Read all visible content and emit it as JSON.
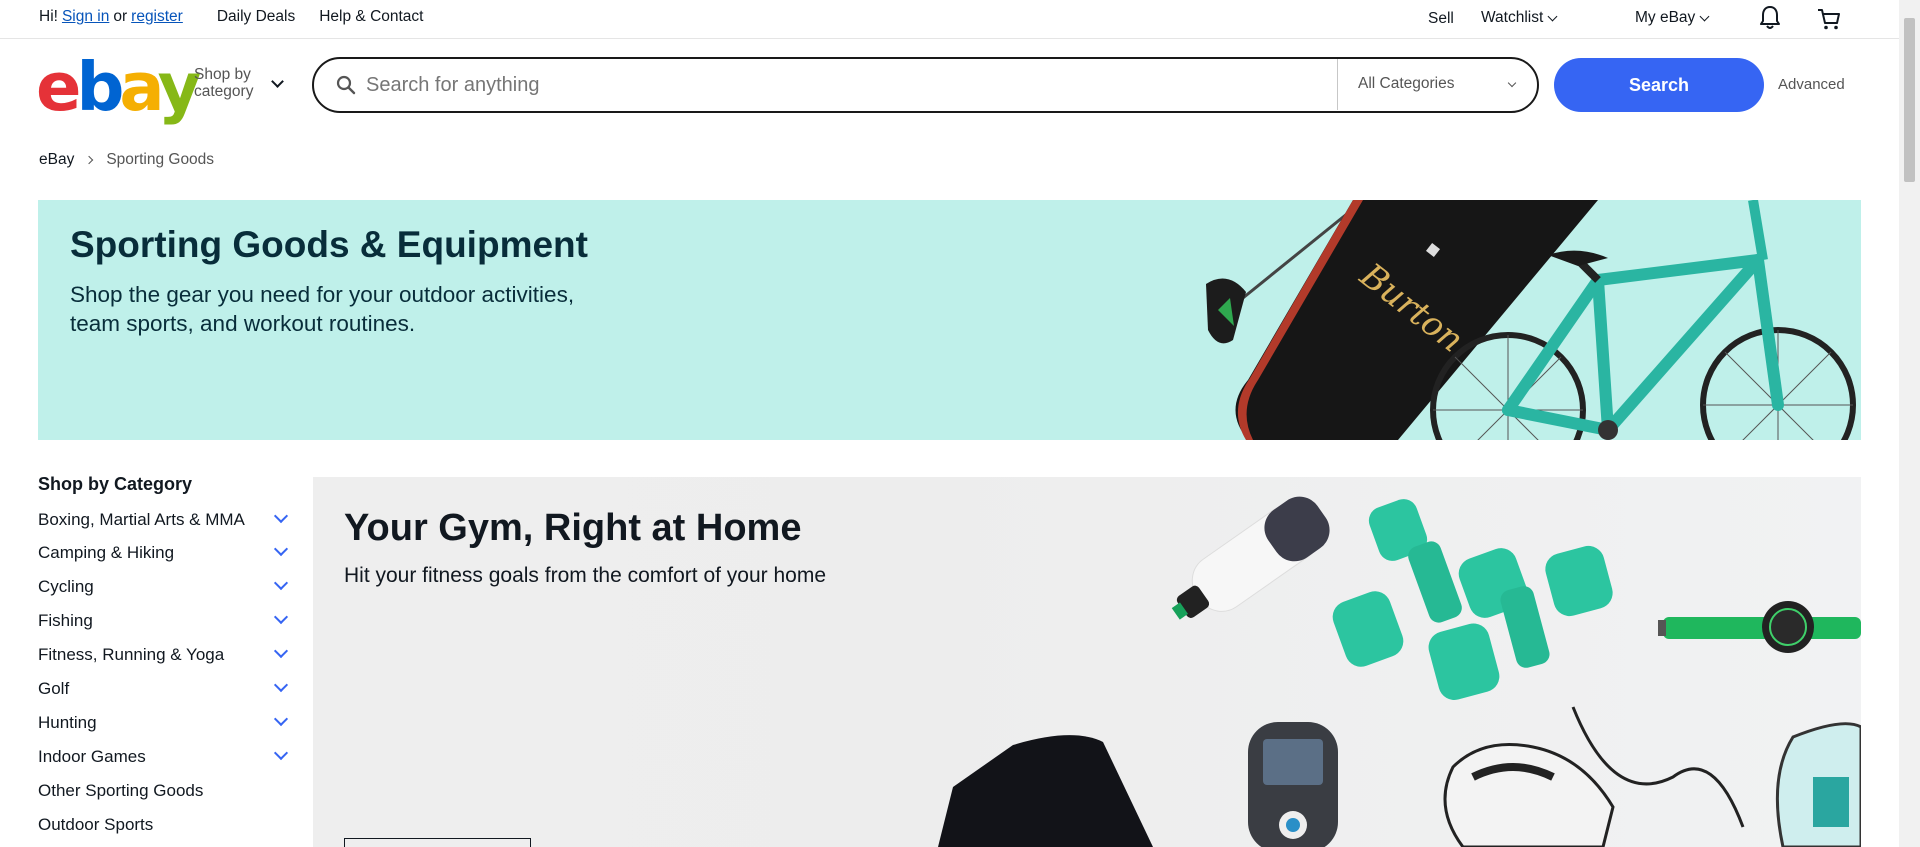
{
  "topbar": {
    "greeting": "Hi!",
    "signin": "Sign in",
    "or": "or",
    "register": "register",
    "daily_deals": "Daily Deals",
    "help": "Help & Contact",
    "sell": "Sell",
    "watchlist": "Watchlist",
    "myebay": "My eBay"
  },
  "header": {
    "logo_letters": [
      "e",
      "b",
      "a",
      "y"
    ],
    "shop_by_line1": "Shop by",
    "shop_by_line2": "category",
    "search_placeholder": "Search for anything",
    "category_select": "All Categories",
    "search_button": "Search",
    "advanced": "Advanced"
  },
  "breadcrumb": {
    "root": "eBay",
    "current": "Sporting Goods"
  },
  "hero": {
    "title": "Sporting Goods & Equipment",
    "subtitle": "Shop the gear you need for your outdoor activities, team sports, and workout routines.",
    "snowboard_brand": "Burton"
  },
  "sidebar": {
    "heading": "Shop by Category",
    "items": [
      {
        "label": "Boxing, Martial Arts & MMA",
        "expandable": true
      },
      {
        "label": "Camping & Hiking",
        "expandable": true
      },
      {
        "label": "Cycling",
        "expandable": true
      },
      {
        "label": "Fishing",
        "expandable": true
      },
      {
        "label": "Fitness, Running & Yoga",
        "expandable": true
      },
      {
        "label": "Golf",
        "expandable": true
      },
      {
        "label": "Hunting",
        "expandable": true
      },
      {
        "label": "Indoor Games",
        "expandable": true
      },
      {
        "label": "Other Sporting Goods",
        "expandable": false
      },
      {
        "label": "Outdoor Sports",
        "expandable": false
      }
    ]
  },
  "gym": {
    "title": "Your Gym, Right at Home",
    "subtitle": "Hit your fitness goals from the comfort of your home"
  },
  "colors": {
    "search_blue": "#3665f3",
    "hero_bg": "#bff0ea",
    "logo_red": "#e53238",
    "logo_blue": "#0064d2",
    "logo_yellow": "#f5af02",
    "logo_green": "#86b817"
  },
  "icons": {
    "notifications": "bell-icon",
    "cart": "cart-icon",
    "search": "magnifier-icon"
  }
}
